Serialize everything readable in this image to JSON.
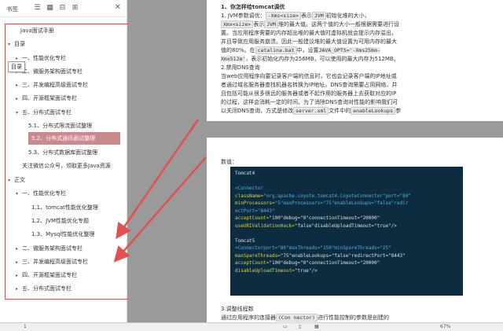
{
  "sidebar": {
    "title": "书签",
    "close_glyph": "✕",
    "tooltip": "目录",
    "items": [
      {
        "label": "Java面试手册",
        "chev": ""
      },
      {
        "label": "目录",
        "chev": "▾"
      },
      {
        "label": "一、性能优化专栏",
        "chev": "▸"
      },
      {
        "label": "二、微服务架构面试专栏",
        "chev": "▸"
      },
      {
        "label": "三、并发编程高级面试专栏",
        "chev": "▸"
      },
      {
        "label": "四、开源框架面试专栏",
        "chev": "▸"
      },
      {
        "label": "五、分布式面试专栏",
        "chev": "▾"
      },
      {
        "label": "5.1、分布式限流面试整理",
        "chev": ""
      },
      {
        "label": "5.2、分布式通讯面试整理",
        "chev": ""
      },
      {
        "label": "5.3、分布式数据库面试整理",
        "chev": ""
      },
      {
        "label": "关注微信公众号，领取更多Java资源",
        "chev": ""
      },
      {
        "label": "正文",
        "chev": "▾"
      },
      {
        "label": "一、性能优化专栏",
        "chev": "▾"
      },
      {
        "label": "1.1、tomcat性能优化整理",
        "chev": ""
      },
      {
        "label": "1.2、JVM性能优化专题",
        "chev": ""
      },
      {
        "label": "1.3、Mysql性能优化整理",
        "chev": ""
      },
      {
        "label": "二、微服务架构面试专栏",
        "chev": "▸"
      },
      {
        "label": "三、并发编程高级面试专栏",
        "chev": "▸"
      },
      {
        "label": "四、开源框架面试专栏",
        "chev": "▸"
      },
      {
        "label": "五、分布式面试专栏",
        "chev": "▸"
      }
    ]
  },
  "page1": {
    "heading": "1、你怎样给tomcat调优",
    "l1a": "1. JVM参数调优：",
    "l1b": "-Xms<size>",
    "l1c": "表示",
    "l1d": "JVM",
    "l1e": "初始化堆的大小，",
    "l2a": "Xmx<size>",
    "l2b": "表示",
    "l2c": "JVM",
    "l2d": "堆的最大值。这两个值的大小一般根据需要进行设",
    "l3": "置。当应用程序需要的内存超出堆的最大值时虚拟机就会提示内存溢出，",
    "l4": "并且导致应用服务崩溃。因此一般建议堆的最大值设置为可用内存的最大",
    "l5a": "值的80%。在",
    "l5b": "catalina.bat",
    "l5c": "中，设置",
    "l5d": "JAVA_OPTS='-Xms256m-",
    "l6a": "Xmx512m'",
    "l6b": "，表示初始化内存为256MB，可以使用的最大内存为512MB。",
    "l7": "2.禁用DNS查询",
    "l8": "当web应用程序向要记录客户端的信息时，它也会记录客户端的IP地址或",
    "l9": "者通过域名服务器查找机器名转换为IP地址。DNS查询需要占用网络，并",
    "l10": "且包括可能从很多很远的服务器或者不起作用的服务器上去获取对应的IP",
    "l11": "的过程，这样会消耗一定的时间。为了消除DNS查询对性能的影响我们可",
    "l12a": "以关闭DNS查询，方式是修改",
    "l12b": "server.xml",
    "l12c": "文件中的",
    "l12d": "enableLookups",
    "l12e": "参"
  },
  "page2": {
    "values_label": "数值：",
    "code": {
      "c1": "Tomcat4",
      "c2": "<Connector",
      "c3a": "className=",
      "c3b": "\"org.apache.coyote.tomcat4.CoyoteConnector\"port=\"80\"",
      "c4a": "minProcessors=",
      "c4b": "\"5\"maxProcessors=\"75\"enableLookups=\"false\"redir",
      "c5": "ectPort=\"8443\"",
      "c6a": "acceptCount=",
      "c6b": "\"100\"debug=\"0\"connectionTimeout=\"20000\"",
      "c7a": "useURIValidationHack=",
      "c7b": "\"false\"disableUploadTimeout=\"true\"/>",
      "c8": "Tomcat5",
      "c9a": "<Connectorport=",
      "c9b": "\"80\"maxThreads=\"150\"minSpareThreads=\"25\"",
      "c10a": "maxSpareThreads=",
      "c10b": "\"75\"enableLookups=\"false\"redirectPort=\"8443\"",
      "c11a": "acceptCount=",
      "c11b": "\"100\"debug=\"0\"connectionTimeout=\"20000\"",
      "c12a": "disableUploadTimeout=",
      "c12b": "\"true\"/>"
    },
    "l_after": "3.调整线程数",
    "l_last_a": "通过应用程序的连接器",
    "l_last_b": "(Con nector)",
    "l_last_c": "进行性能控制的参数是创建的"
  },
  "status": {
    "page": "1",
    "zoom": "67%"
  },
  "colors": {
    "outline_border": "#e35050",
    "arrow": "#e35050",
    "selected_bg": "#c98a8e",
    "code_bg": "#0d2c3f"
  }
}
